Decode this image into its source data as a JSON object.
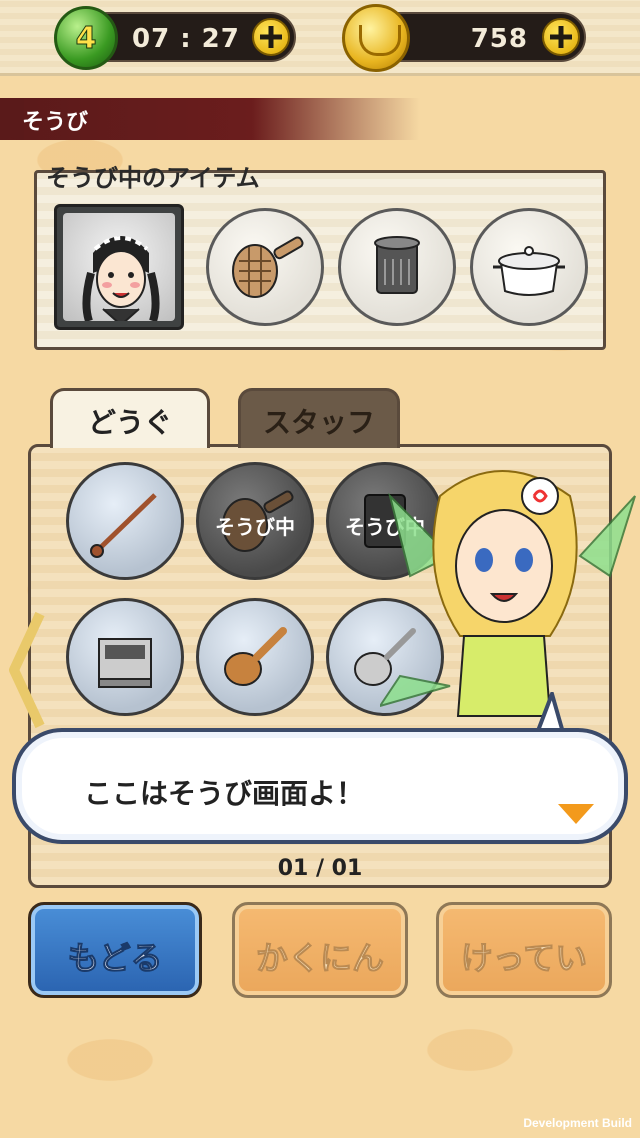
{
  "topbar": {
    "level": "4",
    "timer": "07 : 27",
    "coins": "758"
  },
  "section": {
    "title": "そうび"
  },
  "equipped": {
    "title": "そうび中のアイテム",
    "items": [
      "staff-portrait",
      "strainer-basket",
      "deep-fryer",
      "pot"
    ]
  },
  "tabs": {
    "tools": "どうぐ",
    "staff": "スタッフ"
  },
  "grid": {
    "equipped_label": "そうび中",
    "items": [
      {
        "icon": "ladle-icon",
        "equipped": false
      },
      {
        "icon": "strainer-basket-icon",
        "equipped": true
      },
      {
        "icon": "deep-fryer-icon",
        "equipped": true
      },
      {
        "icon": "stove-icon",
        "equipped": false
      },
      {
        "icon": "rice-paddle-icon",
        "equipped": false
      },
      {
        "icon": "skimmer-icon",
        "equipped": false
      }
    ]
  },
  "pagination": {
    "text": "01 / 01"
  },
  "buttons": {
    "back": "もどる",
    "confirm": "かくにん",
    "decide": "けってい"
  },
  "dialog": {
    "text": "ここはそうび画面よ！"
  },
  "footer": {
    "build": "Development Build"
  },
  "colors": {
    "back_button": "#2a63b0",
    "action_button": "#e27f22",
    "header_bar": "#5a1a1a",
    "level_orb": "#3a9a22"
  }
}
